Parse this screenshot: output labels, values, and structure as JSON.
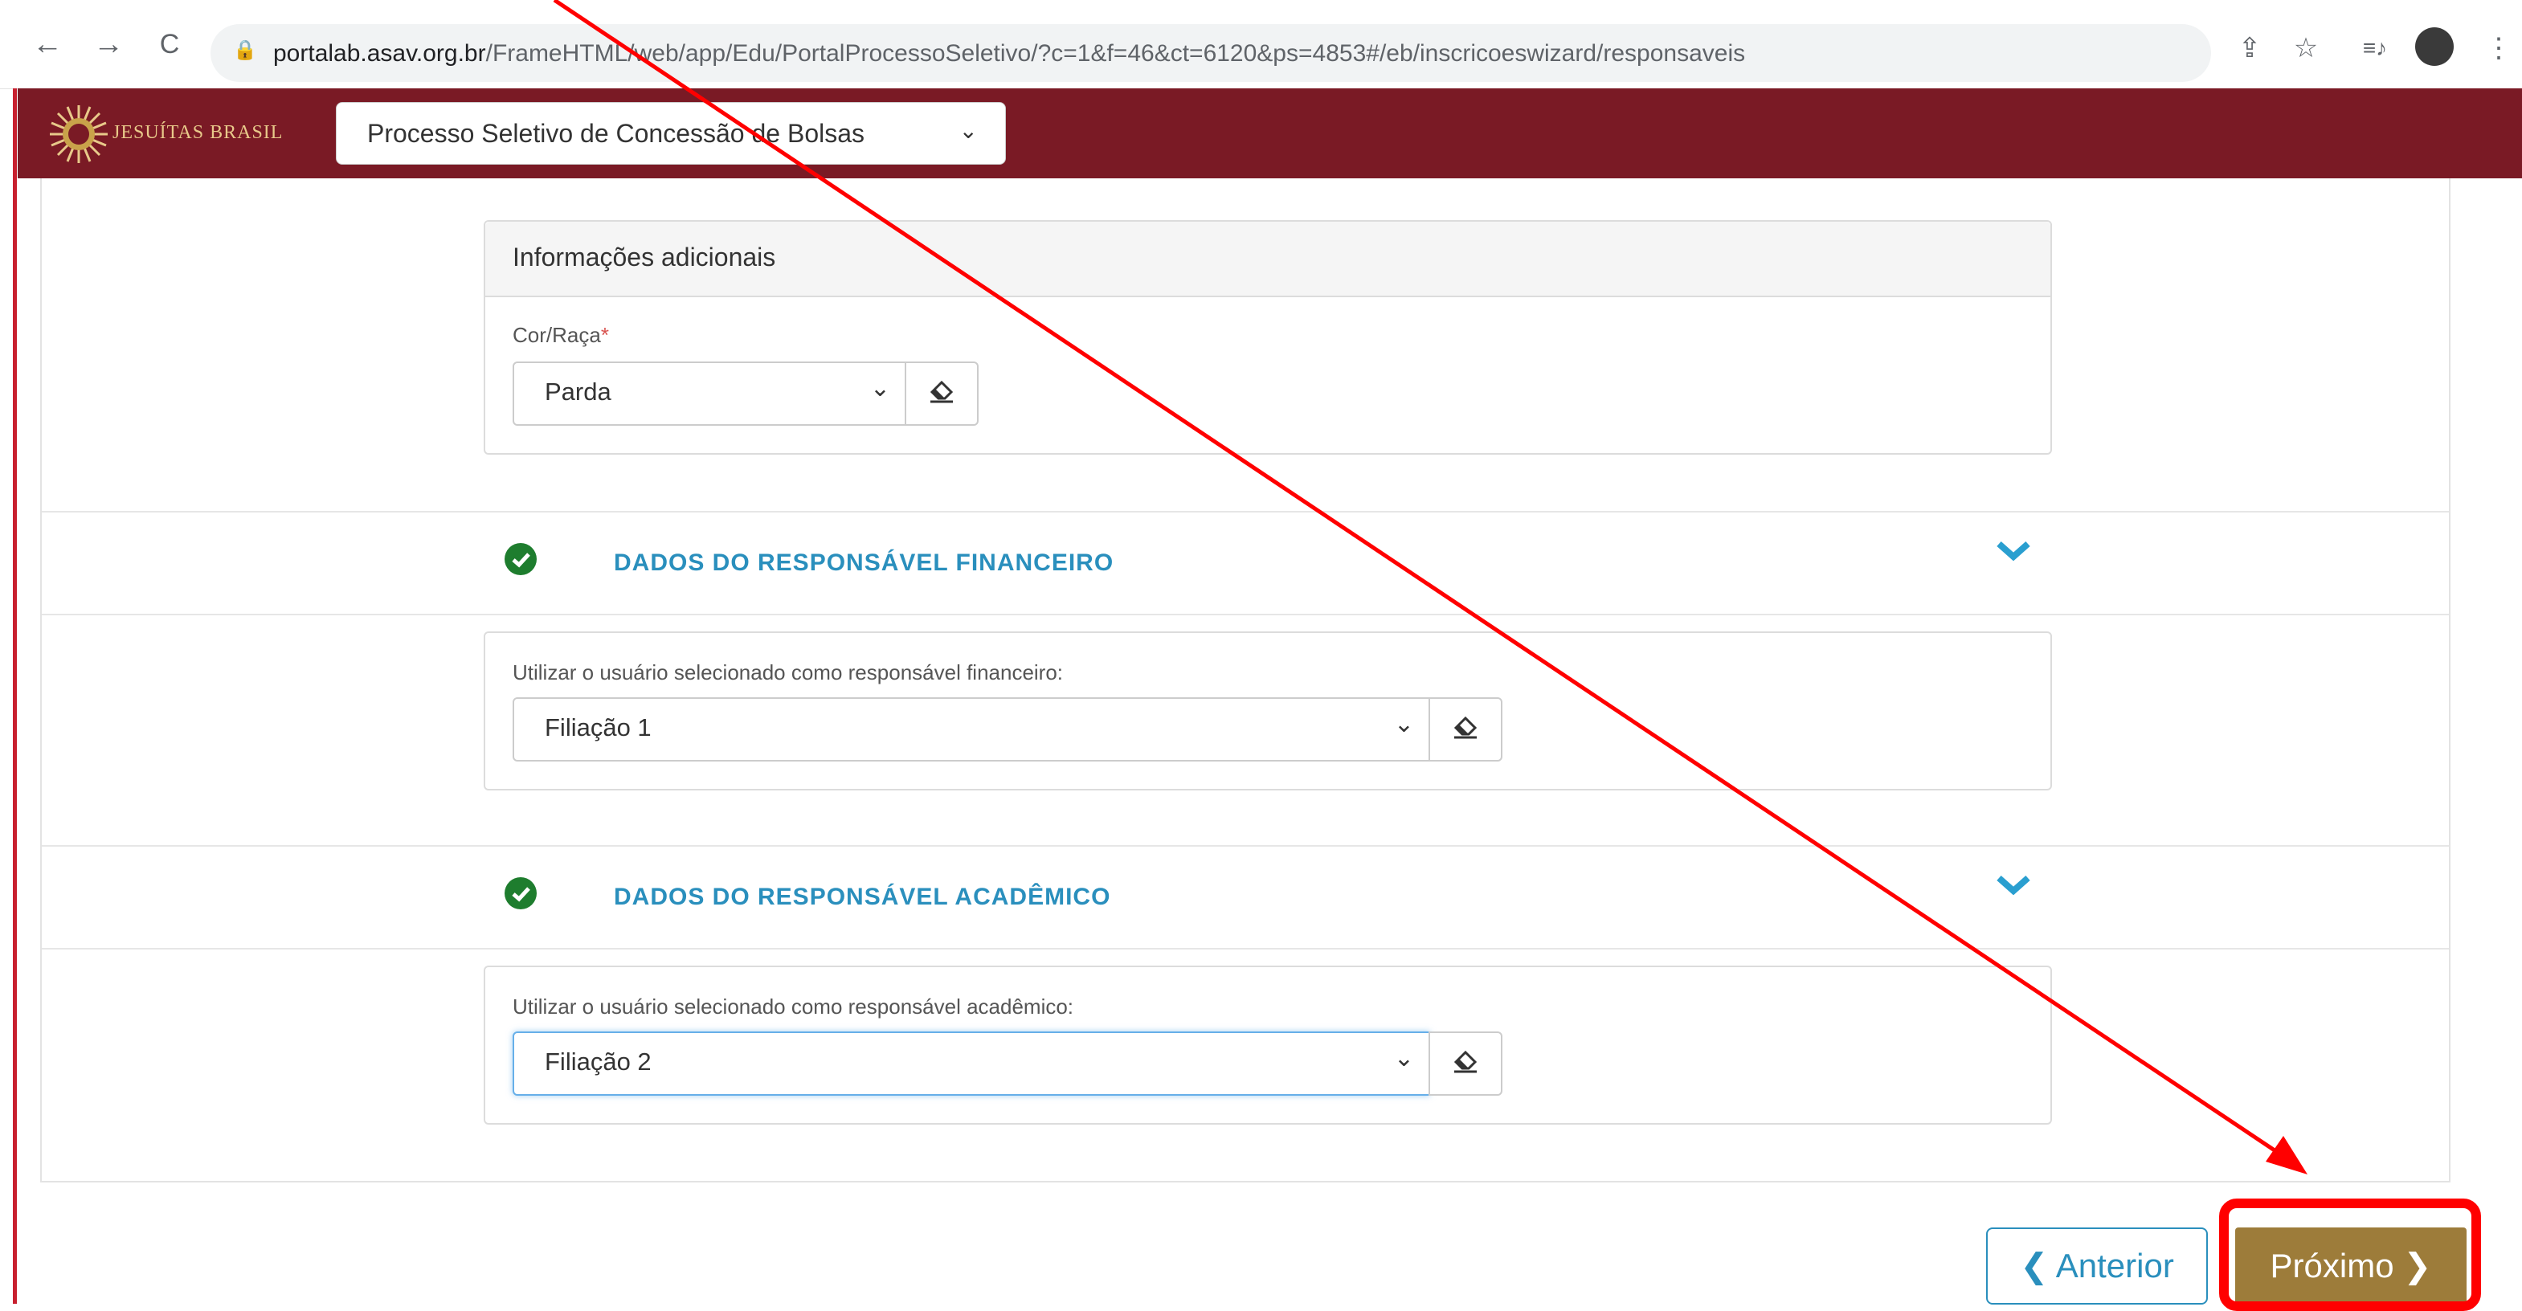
{
  "browser": {
    "url_host": "portalab.asav.org.br",
    "url_path": "/FrameHTML/web/app/Edu/PortalProcessoSeletivo/?c=1&f=46&ct=6120&ps=4853#/eb/inscricoeswizard/responsaveis",
    "back_icon": "←",
    "forward_icon": "→",
    "reload_icon": "C",
    "lock_icon": "🔒",
    "share_icon": "⇪",
    "star_icon": "☆",
    "media_icon": "≡♪",
    "menu_icon": "⋮"
  },
  "header": {
    "brand": "JESUÍTAS BRASIL",
    "process_select_value": "Processo Seletivo de Concessão de Bolsas",
    "background_color": "#7a1a25"
  },
  "additional_info": {
    "title": "Informações adicionais",
    "cor_raca_label": "Cor/Raça",
    "required_mark": "*",
    "cor_raca_value": "Parda"
  },
  "financial": {
    "section_title": "DADOS DO RESPONSÁVEL FINANCEIRO",
    "field_label": "Utilizar o usuário selecionado como responsável financeiro:",
    "value": "Filiação 1"
  },
  "academic": {
    "section_title": "DADOS DO RESPONSÁVEL ACADÊMICO",
    "field_label": "Utilizar o usuário selecionado como responsável acadêmico:",
    "value": "Filiação 2"
  },
  "footer": {
    "prev_label": "Anterior",
    "next_label": "Próximo",
    "prev_icon": "❮",
    "next_icon": "❯"
  },
  "colors": {
    "accent_blue": "#2a8fbd",
    "success_green": "#1e7d2e",
    "next_button": "#9d7c3a",
    "annotation_red": "#ff0000"
  }
}
